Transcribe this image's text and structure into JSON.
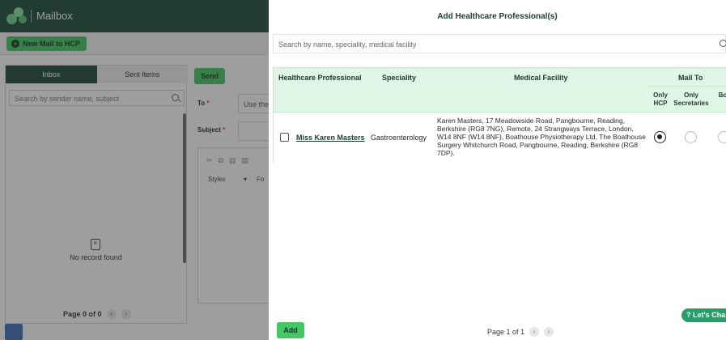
{
  "app": {
    "title": "Mailbox",
    "new_mail_label": "New Mail to HCP",
    "tabs": [
      "Inbox",
      "Sent Items"
    ],
    "search_placeholder": "Search by sender name, subject",
    "empty_text": "No record found",
    "pager_text": "Page 0 of 0",
    "send_label": "Send",
    "to_label": "To",
    "to_placeholder": "Use the",
    "subject_label": "Subject",
    "required_mark": "*",
    "editor_styles_label": "Styles",
    "editor_font_label": "Fo"
  },
  "modal": {
    "title": "Add Healthcare Professional(s)",
    "search_placeholder": "Search by name, speciality, medical facility",
    "columns": {
      "hcp": "Healthcare Professional",
      "speciality": "Speciality",
      "facility": "Medical Facility",
      "mail_to": "Mail To"
    },
    "mail_to_options": [
      "Only HCP",
      "Only Secretaries",
      "Bo"
    ],
    "rows": [
      {
        "name": "Miss Karen Masters",
        "speciality": "Gastroenterology",
        "facility": "Karen Masters, 17 Meadowside Road, Pangbourne, Reading, Berkshire (RG8 7NG), Remote, 24 Strangways Terrace, London, W14 8NF (W14 8NF), Boathouse Physiotherapy Ltd, The Boathouse Surgery Whitchurch Road, Pangbourne, Reading, Berkshire (RG8 7DP).",
        "checked": false,
        "mail_to_selected": "Only HCP"
      }
    ],
    "add_label": "Add",
    "pager_text": "Page 1 of 1",
    "chat_label": "Let's Cha"
  }
}
